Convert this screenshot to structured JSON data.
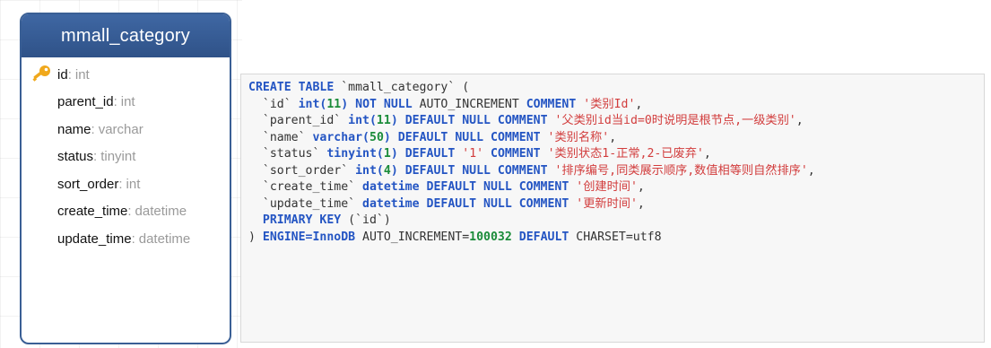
{
  "er_table": {
    "title": "mmall_category",
    "fields": [
      {
        "name": "id",
        "type": "int",
        "primary_key": true
      },
      {
        "name": "parent_id",
        "type": "int"
      },
      {
        "name": "name",
        "type": "varchar"
      },
      {
        "name": "status",
        "type": "tinyint"
      },
      {
        "name": "sort_order",
        "type": "int"
      },
      {
        "name": "create_time",
        "type": "datetime"
      },
      {
        "name": "update_time",
        "type": "datetime"
      }
    ]
  },
  "sql": {
    "lines": [
      [
        {
          "k": "kw",
          "t": "CREATE TABLE"
        },
        {
          "k": "plain",
          "t": " `mmall_category` ("
        }
      ],
      [
        {
          "k": "plain",
          "t": "  `id` "
        },
        {
          "k": "kw",
          "t": "int("
        },
        {
          "k": "num",
          "t": "11"
        },
        {
          "k": "kw",
          "t": ")"
        },
        {
          "k": "plain",
          "t": " "
        },
        {
          "k": "kw",
          "t": "NOT NULL"
        },
        {
          "k": "plain",
          "t": " AUTO_INCREMENT "
        },
        {
          "k": "kw",
          "t": "COMMENT"
        },
        {
          "k": "plain",
          "t": " "
        },
        {
          "k": "str",
          "t": "'类别Id'"
        },
        {
          "k": "plain",
          "t": ","
        }
      ],
      [
        {
          "k": "plain",
          "t": "  `parent_id` "
        },
        {
          "k": "kw",
          "t": "int("
        },
        {
          "k": "num",
          "t": "11"
        },
        {
          "k": "kw",
          "t": ")"
        },
        {
          "k": "plain",
          "t": " "
        },
        {
          "k": "kw",
          "t": "DEFAULT NULL COMMENT"
        },
        {
          "k": "plain",
          "t": " "
        },
        {
          "k": "str",
          "t": "'父类别id当id=0时说明是根节点,一级类别'"
        },
        {
          "k": "plain",
          "t": ","
        }
      ],
      [
        {
          "k": "plain",
          "t": "  `name` "
        },
        {
          "k": "kw",
          "t": "varchar("
        },
        {
          "k": "num",
          "t": "50"
        },
        {
          "k": "kw",
          "t": ")"
        },
        {
          "k": "plain",
          "t": " "
        },
        {
          "k": "kw",
          "t": "DEFAULT NULL COMMENT"
        },
        {
          "k": "plain",
          "t": " "
        },
        {
          "k": "str",
          "t": "'类别名称'"
        },
        {
          "k": "plain",
          "t": ","
        }
      ],
      [
        {
          "k": "plain",
          "t": "  `status` "
        },
        {
          "k": "kw",
          "t": "tinyint("
        },
        {
          "k": "num",
          "t": "1"
        },
        {
          "k": "kw",
          "t": ")"
        },
        {
          "k": "plain",
          "t": " "
        },
        {
          "k": "kw",
          "t": "DEFAULT"
        },
        {
          "k": "plain",
          "t": " "
        },
        {
          "k": "str",
          "t": "'1'"
        },
        {
          "k": "plain",
          "t": " "
        },
        {
          "k": "kw",
          "t": "COMMENT"
        },
        {
          "k": "plain",
          "t": " "
        },
        {
          "k": "str",
          "t": "'类别状态1-正常,2-已废弃'"
        },
        {
          "k": "plain",
          "t": ","
        }
      ],
      [
        {
          "k": "plain",
          "t": "  `sort_order` "
        },
        {
          "k": "kw",
          "t": "int("
        },
        {
          "k": "num",
          "t": "4"
        },
        {
          "k": "kw",
          "t": ")"
        },
        {
          "k": "plain",
          "t": " "
        },
        {
          "k": "kw",
          "t": "DEFAULT NULL COMMENT"
        },
        {
          "k": "plain",
          "t": " "
        },
        {
          "k": "str",
          "t": "'排序编号,同类展示顺序,数值相等则自然排序'"
        },
        {
          "k": "plain",
          "t": ","
        }
      ],
      [
        {
          "k": "plain",
          "t": "  `create_time` "
        },
        {
          "k": "kw",
          "t": "datetime DEFAULT NULL COMMENT"
        },
        {
          "k": "plain",
          "t": " "
        },
        {
          "k": "str",
          "t": "'创建时间'"
        },
        {
          "k": "plain",
          "t": ","
        }
      ],
      [
        {
          "k": "plain",
          "t": "  `update_time` "
        },
        {
          "k": "kw",
          "t": "datetime DEFAULT NULL COMMENT"
        },
        {
          "k": "plain",
          "t": " "
        },
        {
          "k": "str",
          "t": "'更新时间'"
        },
        {
          "k": "plain",
          "t": ","
        }
      ],
      [
        {
          "k": "plain",
          "t": "  "
        },
        {
          "k": "kw",
          "t": "PRIMARY KEY"
        },
        {
          "k": "plain",
          "t": " (`id`)"
        }
      ],
      [
        {
          "k": "plain",
          "t": ") "
        },
        {
          "k": "kw",
          "t": "ENGINE=InnoDB"
        },
        {
          "k": "plain",
          "t": " AUTO_INCREMENT="
        },
        {
          "k": "num",
          "t": "100032"
        },
        {
          "k": "plain",
          "t": " "
        },
        {
          "k": "kw",
          "t": "DEFAULT"
        },
        {
          "k": "plain",
          "t": " CHARSET=utf8"
        }
      ]
    ]
  },
  "colors": {
    "header_bg": "#3f67a3",
    "keyword": "#2455c3",
    "number": "#1b8c3a",
    "string": "#d23d3d",
    "key_icon": "#f0a81c"
  }
}
